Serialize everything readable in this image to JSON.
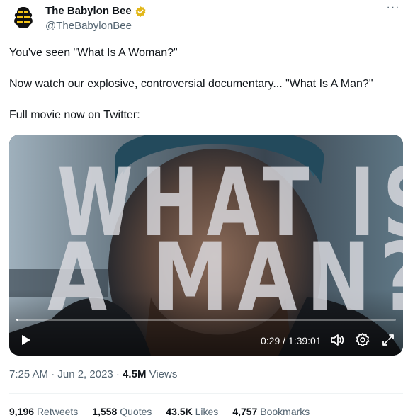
{
  "author": {
    "name": "The Babylon Bee",
    "handle": "@TheBabylonBee",
    "avatar_icon": "bee-logo",
    "verified_badge": "gold-verified-icon",
    "verified_color": "#e2b719"
  },
  "tweet": {
    "lines": [
      "You've seen \"What Is A Woman?\"",
      "Now watch our explosive, controversial documentary... \"What Is A Man?\"",
      "Full movie now on Twitter:"
    ]
  },
  "video": {
    "overlay_line1": "WHAT IS",
    "overlay_line2": "A MAN?",
    "time": "0:29 / 1:39:01",
    "progress_fraction": 0.005
  },
  "meta": {
    "timestamp": "7:25 AM · Jun 2, 2023 · ",
    "views_count": "4.5M",
    "views_label": " Views"
  },
  "stats": [
    {
      "count": "9,196",
      "label": "Retweets"
    },
    {
      "count": "1,558",
      "label": "Quotes"
    },
    {
      "count": "43.5K",
      "label": "Likes"
    },
    {
      "count": "4,757",
      "label": "Bookmarks"
    }
  ]
}
